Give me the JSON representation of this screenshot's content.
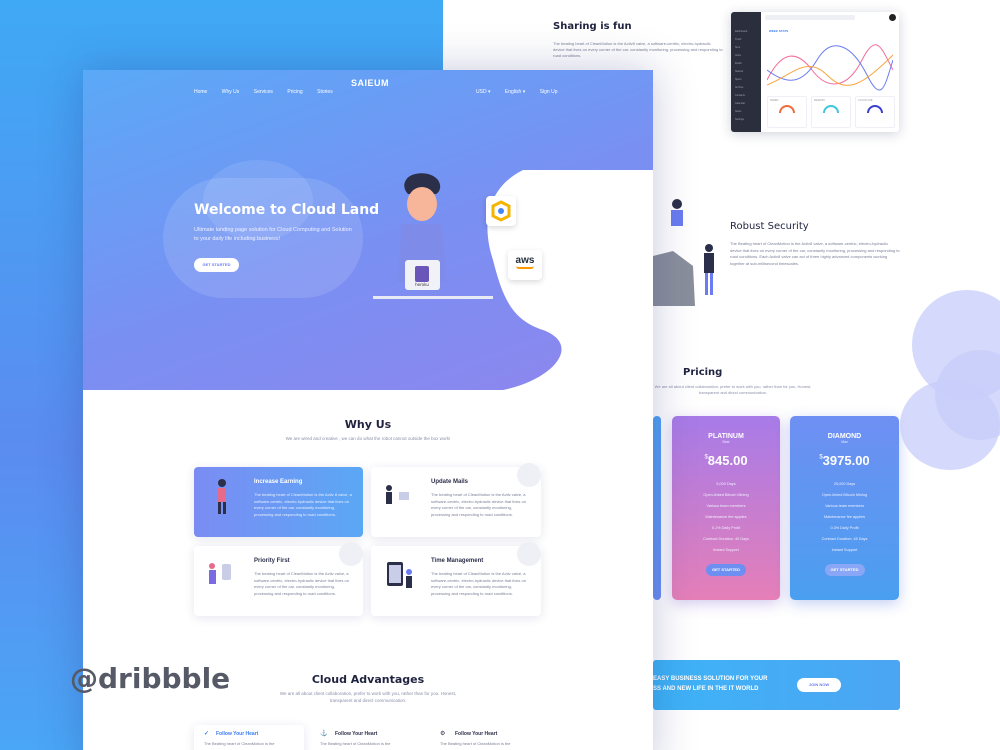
{
  "watermark": "@dribbble",
  "front": {
    "nav": {
      "links": [
        "Home",
        "Why Us",
        "Services",
        "Pricing",
        "Stories"
      ],
      "logo": "SAIEUM",
      "right": [
        "USD ▾",
        "English ▾",
        "Sign Up"
      ]
    },
    "hero": {
      "title": "Welcome to  Cloud Land",
      "subtitle": "Ultimate landing page solution for Cloud Computing and Solution to your daily life including business!",
      "cta": "GET STARTED",
      "laptop_label": "heroku",
      "aws_label": "aws"
    },
    "why": {
      "title": "Why Us",
      "subtitle": "We are wired and creative , we can do what the robot cannot outside the box work!",
      "cards": [
        {
          "title": "Increase Earning",
          "text": "The beating heart of CleanMotion is the Activ 8 valve, a software-centric, electro-hydraulic device that lives on every corner of the car, constantly monitoring, processing and responding to road conditions."
        },
        {
          "title": "Update Mails",
          "text": "The beating heart of CleanMotion is the Activ valve, a software-centric, electro-hydraulic device that lives on every corner of the car, constantly monitoring, processing and responding to road conditions."
        },
        {
          "title": "Priority First",
          "text": "The beating heart of CleanMotion is the Activ valve, a software-centric, electro-hydraulic device that lives on every corner of the car, constantly monitoring, processing and responding to road conditions."
        },
        {
          "title": "Time Management",
          "text": "The beating heart of CleanMotion is the Activ valve, a software-centric, electro-hydraulic device that lives on every corner of the car, constantly monitoring, processing and responding to road conditions."
        }
      ]
    },
    "advantages": {
      "title": "Cloud Advantages",
      "subtitle": "We are all about client collaboration, prefer to work with you, rather than for you. Honest, transparent and direct communication.",
      "items": [
        {
          "title": "Follow Your Heart",
          "text": "The Beating heart of CleanMotion is the"
        },
        {
          "title": "Follow Your Heart",
          "text": "The Beating heart of CleanMotion is the"
        },
        {
          "title": "Follow Your Heart",
          "text": "The Beating heart of CleanMotion is the"
        }
      ]
    }
  },
  "back": {
    "sharing": {
      "title": "Sharing is fun",
      "text": "The beating heart of CleanMotion is the Activ8 valve, a software-centric, electro-hydraulic device that lives on every corner of the car, constantly monitoring, processing and responding to road conditions."
    },
    "security": {
      "title": "Robust Security",
      "text": "The Beating heart of CleanMotion is the Activ8 valve, a software-centric, electro-hydraulic device that lives on every corner of the car, constantly monitoring, processing and responding to road conditions. Each Activ8 valve can act of three highly advanced components working together at sub-millisecond timescales."
    },
    "pricing": {
      "title": "Pricing",
      "subtitle": "We are all about client collaboration, prefer to work with you, rather than for you. Honest, transparent and direct communication.",
      "plans": [
        {
          "name": "PLATINUM",
          "tag": "Best",
          "currency": "$",
          "amount": "845.00",
          "features": [
            "5,000 Days",
            "Open-linked Bitcoin Mining",
            "Various team members",
            "Maintenance fee applies",
            "0.1% Daily Profit",
            "Contract Duration: 45 Days",
            "Instant Support"
          ],
          "cta": "GET STARTED"
        },
        {
          "name": "DIAMOND",
          "tag": "Max",
          "currency": "$",
          "amount": "3975.00",
          "features": [
            "25,000 Days",
            "Open-linked Bitcoin Mining",
            "Various team members",
            "Maintenance fee applies",
            "0.3% Daily Profit",
            "Contract Duration: 45 Days",
            "Instant Support"
          ],
          "cta": "GET STARTED"
        }
      ]
    },
    "banner": {
      "line1": "EASY BUSINESS SOLUTION FOR YOUR",
      "line2": "SS AND NEW LIFE IN THE IT WORLD",
      "cta": "JOIN NOW"
    },
    "dashboard": {
      "menu": [
        "Dashboard",
        "Trash",
        "Sent",
        "Inbox",
        "Drafts",
        "Starred",
        "Spam",
        "Archive",
        "Contacts",
        "Calendar",
        "Notes",
        "Settings"
      ],
      "chart_heading": "WEEK STATS",
      "stats": [
        {
          "label": "SPEED",
          "color": "#f26b3a"
        },
        {
          "label": "MEMORY",
          "color": "#3cc6e0"
        },
        {
          "label": "CLOUD USE",
          "color": "#3b3fd1"
        }
      ]
    }
  },
  "colors": {
    "accent": "#6a7cf0",
    "platinum_top": "#a77be8",
    "platinum_bottom": "#e57fb8",
    "diamond_top": "#6f8ff3",
    "diamond_bottom": "#4a9ff0"
  }
}
